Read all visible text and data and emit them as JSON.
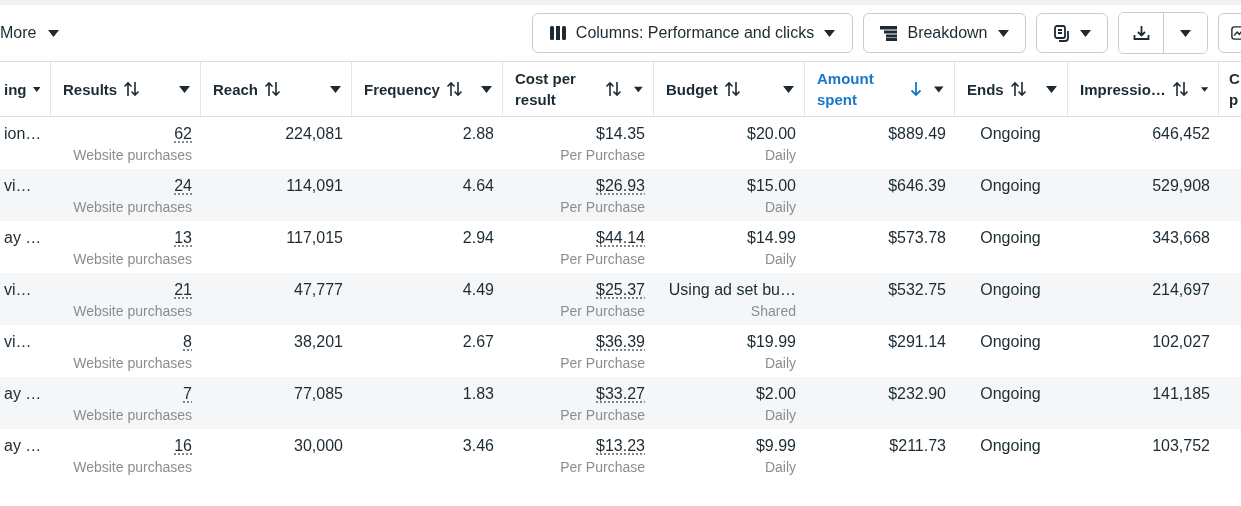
{
  "toolbar": {
    "more": "More",
    "buttons": [
      {
        "kind": "columns",
        "label": "Columns: Performance and clicks"
      },
      {
        "kind": "breakdown",
        "label": "Breakdown"
      },
      {
        "kind": "reports"
      },
      {
        "kind": "export"
      },
      {
        "kind": "chart"
      }
    ]
  },
  "table": {
    "columns": [
      {
        "label": "ing",
        "sortable": false,
        "caret": true
      },
      {
        "label": "Results",
        "sortable": true,
        "sorted": false,
        "caret": true
      },
      {
        "label": "Reach",
        "sortable": true,
        "sorted": false,
        "caret": true
      },
      {
        "label": "Frequency",
        "sortable": true,
        "sorted": false,
        "caret": true
      },
      {
        "label": "Cost per result",
        "sortable": true,
        "sorted": false,
        "caret": true
      },
      {
        "label": "Budget",
        "sortable": true,
        "sorted": false,
        "caret": true
      },
      {
        "label": "Amount spent",
        "sortable": true,
        "sorted": true,
        "caret": true
      },
      {
        "label": "Ends",
        "sortable": true,
        "sorted": false,
        "caret": true
      },
      {
        "label": "Impressio…",
        "sortable": true,
        "sorted": false,
        "caret": true
      },
      {
        "label": "C p",
        "sortable": false,
        "caret": false
      }
    ],
    "rows": [
      {
        "name": "ion…",
        "results": "62",
        "result_type": "Website purchases",
        "reach": "224,081",
        "frequency": "2.88",
        "cost_per_result": "$14.35",
        "cost_dotted": false,
        "cost_type": "Per Purchase",
        "budget": "$20.00",
        "budget_type": "Daily",
        "amount_spent": "$889.49",
        "ends": "Ongoing",
        "impressions": "646,452"
      },
      {
        "name": "vi…",
        "results": "24",
        "result_type": "Website purchases",
        "reach": "114,091",
        "frequency": "4.64",
        "cost_per_result": "$26.93",
        "cost_dotted": true,
        "cost_type": "Per Purchase",
        "budget": "$15.00",
        "budget_type": "Daily",
        "amount_spent": "$646.39",
        "ends": "Ongoing",
        "impressions": "529,908"
      },
      {
        "name": "ay …",
        "results": "13",
        "result_type": "Website purchases",
        "reach": "117,015",
        "frequency": "2.94",
        "cost_per_result": "$44.14",
        "cost_dotted": true,
        "cost_type": "Per Purchase",
        "budget": "$14.99",
        "budget_type": "Daily",
        "amount_spent": "$573.78",
        "ends": "Ongoing",
        "impressions": "343,668"
      },
      {
        "name": "vi…",
        "results": "21",
        "result_type": "Website purchases",
        "reach": "47,777",
        "frequency": "4.49",
        "cost_per_result": "$25.37",
        "cost_dotted": true,
        "cost_type": "Per Purchase",
        "budget": "Using ad set bu…",
        "budget_type": "Shared",
        "amount_spent": "$532.75",
        "ends": "Ongoing",
        "impressions": "214,697"
      },
      {
        "name": "vi…",
        "results": "8",
        "result_type": "Website purchases",
        "reach": "38,201",
        "frequency": "2.67",
        "cost_per_result": "$36.39",
        "cost_dotted": true,
        "cost_type": "Per Purchase",
        "budget": "$19.99",
        "budget_type": "Daily",
        "amount_spent": "$291.14",
        "ends": "Ongoing",
        "impressions": "102,027"
      },
      {
        "name": "ay …",
        "results": "7",
        "result_type": "Website purchases",
        "reach": "77,085",
        "frequency": "1.83",
        "cost_per_result": "$33.27",
        "cost_dotted": true,
        "cost_type": "Per Purchase",
        "budget": "$2.00",
        "budget_type": "Daily",
        "amount_spent": "$232.90",
        "ends": "Ongoing",
        "impressions": "141,185"
      },
      {
        "name": "ay …",
        "results": "16",
        "result_type": "Website purchases",
        "reach": "30,000",
        "frequency": "3.46",
        "cost_per_result": "$13.23",
        "cost_dotted": true,
        "cost_type": "Per Purchase",
        "budget": "$9.99",
        "budget_type": "Daily",
        "amount_spent": "$211.73",
        "ends": "Ongoing",
        "impressions": "103,752"
      }
    ]
  }
}
